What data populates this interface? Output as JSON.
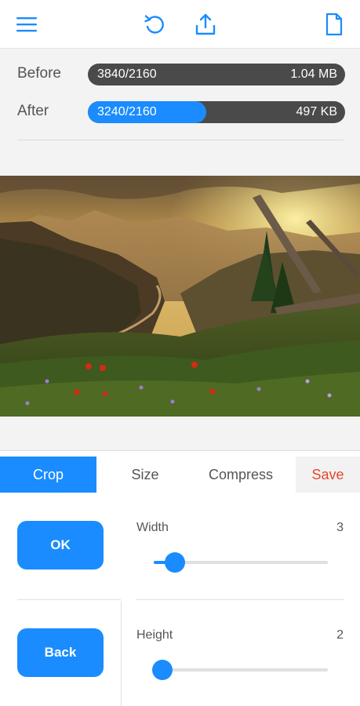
{
  "toolbar": {
    "menu_icon": "menu-icon",
    "undo_icon": "undo-icon",
    "share_icon": "share-icon",
    "file_icon": "file-icon",
    "accent": "#1a8cff"
  },
  "info": {
    "before": {
      "label": "Before",
      "resolution": "3840/2160",
      "size": "1.04 MB",
      "fill": 0
    },
    "after": {
      "label": "After",
      "resolution": "3240/2160",
      "size": "497 KB",
      "fill": 0.46
    }
  },
  "image": {
    "icon": "landscape-photo"
  },
  "tabs": [
    {
      "label": "Crop",
      "active": true
    },
    {
      "label": "Size",
      "active": false
    },
    {
      "label": "Compress",
      "active": false
    },
    {
      "label": "Save",
      "active": false
    }
  ],
  "controls": {
    "ok_label": "OK",
    "back_label": "Back",
    "width": {
      "label": "Width",
      "value": "3",
      "level": 0.12
    },
    "height": {
      "label": "Height",
      "value": "2",
      "level": 0.05
    }
  },
  "colors": {
    "accent": "#1a8cff",
    "save": "#e8462b",
    "bar_bg": "#4a4a4a"
  }
}
